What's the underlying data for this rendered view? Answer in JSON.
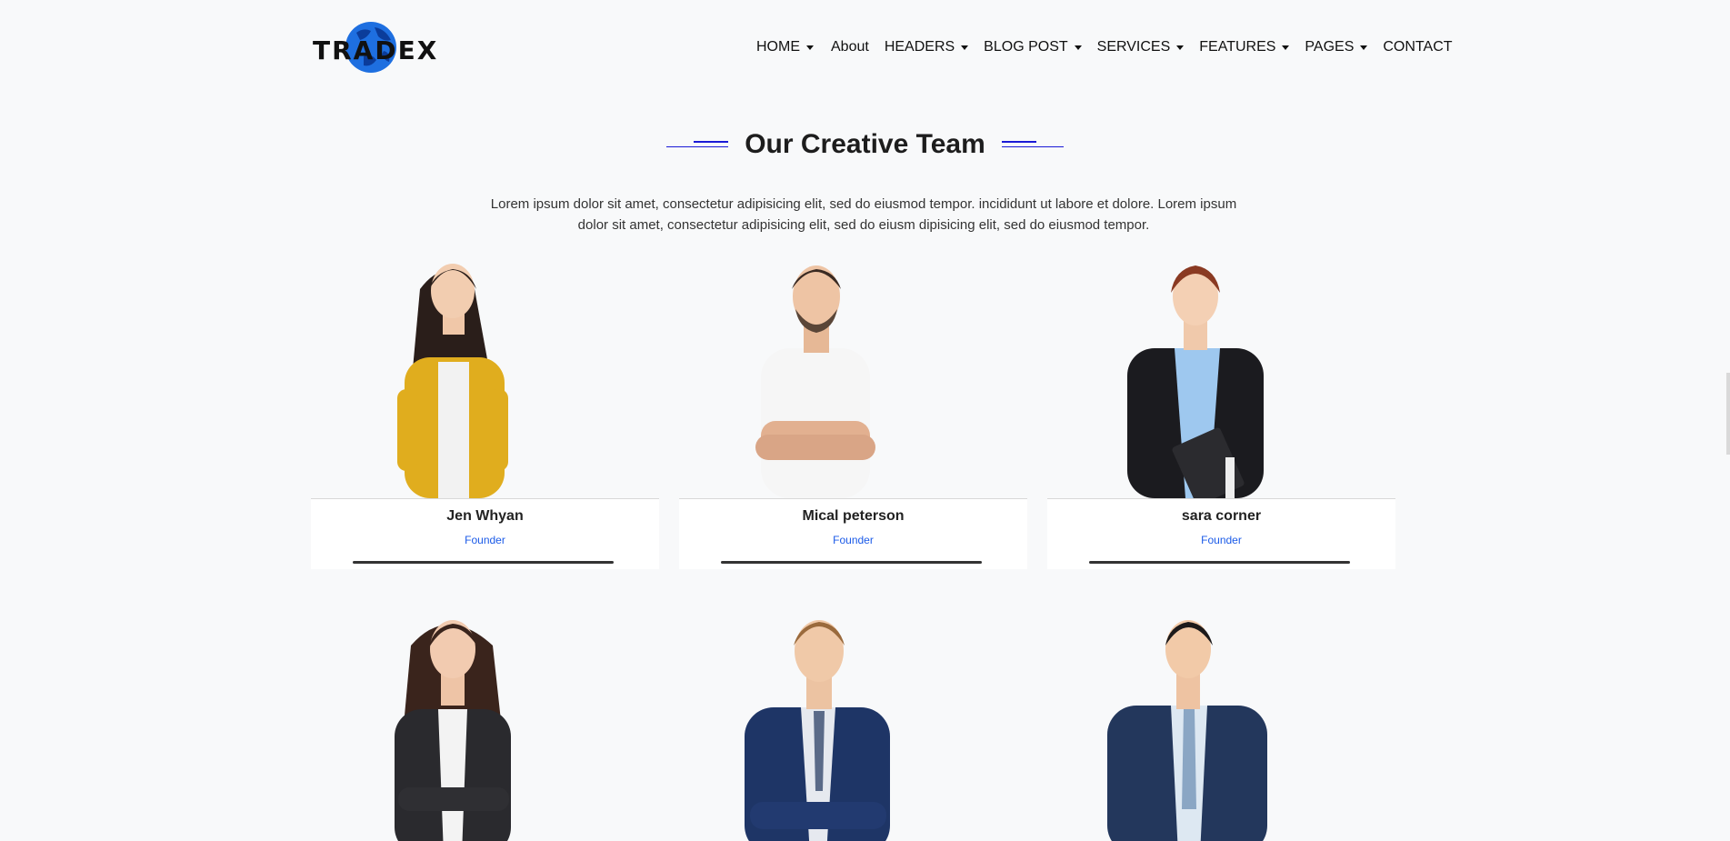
{
  "brand": {
    "name": "TRADEX"
  },
  "nav": {
    "items": [
      {
        "label": "HOME",
        "dropdown": true
      },
      {
        "label": "About",
        "dropdown": false
      },
      {
        "label": "HEADERS",
        "dropdown": true
      },
      {
        "label": "BLOG POST",
        "dropdown": true
      },
      {
        "label": "SERVICES",
        "dropdown": true
      },
      {
        "label": "FEATURES",
        "dropdown": true
      },
      {
        "label": "PAGES",
        "dropdown": true
      },
      {
        "label": "CONTACT",
        "dropdown": false
      }
    ]
  },
  "section": {
    "title": "Our Creative Team",
    "intro": "Lorem ipsum dolor sit amet, consectetur adipisicing elit, sed do eiusmod tempor. incididunt ut labore et dolore. Lorem ipsum dolor sit amet, consectetur adipisicing elit, sed do eiusm dipisicing elit, sed do eiusmod tempor."
  },
  "team": [
    {
      "name": "Jen Whyan",
      "role": "Founder"
    },
    {
      "name": "Mical peterson",
      "role": "Founder"
    },
    {
      "name": "sara corner",
      "role": "Founder"
    }
  ],
  "colors": {
    "accent": "#1a1ad6",
    "role": "#1a5ae8",
    "background": "#f8f9fa"
  }
}
